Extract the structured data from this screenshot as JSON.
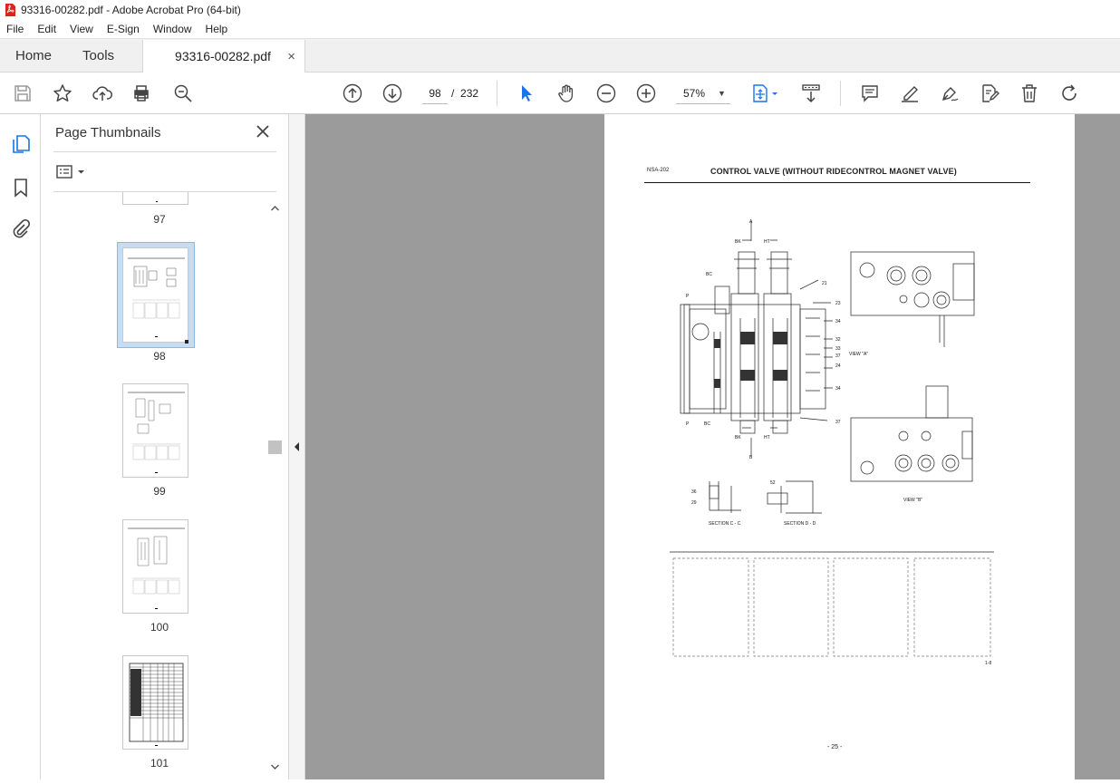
{
  "window": {
    "title": "93316-00282.pdf - Adobe Acrobat Pro (64-bit)"
  },
  "menu": [
    "File",
    "Edit",
    "View",
    "E-Sign",
    "Window",
    "Help"
  ],
  "tabs": {
    "home": "Home",
    "tools": "Tools",
    "doc": "93316-00282.pdf",
    "close": "×"
  },
  "toolbar": {
    "page_current": "98",
    "page_sep": "/",
    "page_total": "232",
    "zoom": "57%"
  },
  "panel": {
    "title": "Page Thumbnails",
    "thumbnails": [
      {
        "label": "97"
      },
      {
        "label": "98",
        "selected": true
      },
      {
        "label": "99"
      },
      {
        "label": "100"
      },
      {
        "label": "101"
      }
    ]
  },
  "document": {
    "code": "NSA-202",
    "title": "CONTROL VALVE (WITHOUT RIDECONTROL MAGNET VALVE)",
    "footer": "- 25 -",
    "corner": "1-8",
    "labels": {
      "view_a": "VIEW \"A\"",
      "view_b": "VIEW \"B\"",
      "section_cc": "SECTION C - C",
      "section_dd": "SECTION D - D",
      "a": "A",
      "b": "B",
      "bk_top": "BK",
      "ht_top": "HT",
      "bk_bot": "BK",
      "ht_bot": "HT",
      "bc_top": "BC",
      "bc_bot": "BC",
      "p_top": "P",
      "p_bot": "P",
      "n21": "21",
      "n23": "23",
      "n34a": "34",
      "n32": "32",
      "n33": "33",
      "n37a": "37",
      "n24": "24",
      "n34b": "34",
      "n37b": "37",
      "n36": "36",
      "n29": "29",
      "n52": "52"
    }
  },
  "colors": {
    "accent": "#1a73e8",
    "doc_bg": "#9b9b9b",
    "selected_thumb": "#c5dcf2",
    "pdf_red": "#d8261c"
  }
}
